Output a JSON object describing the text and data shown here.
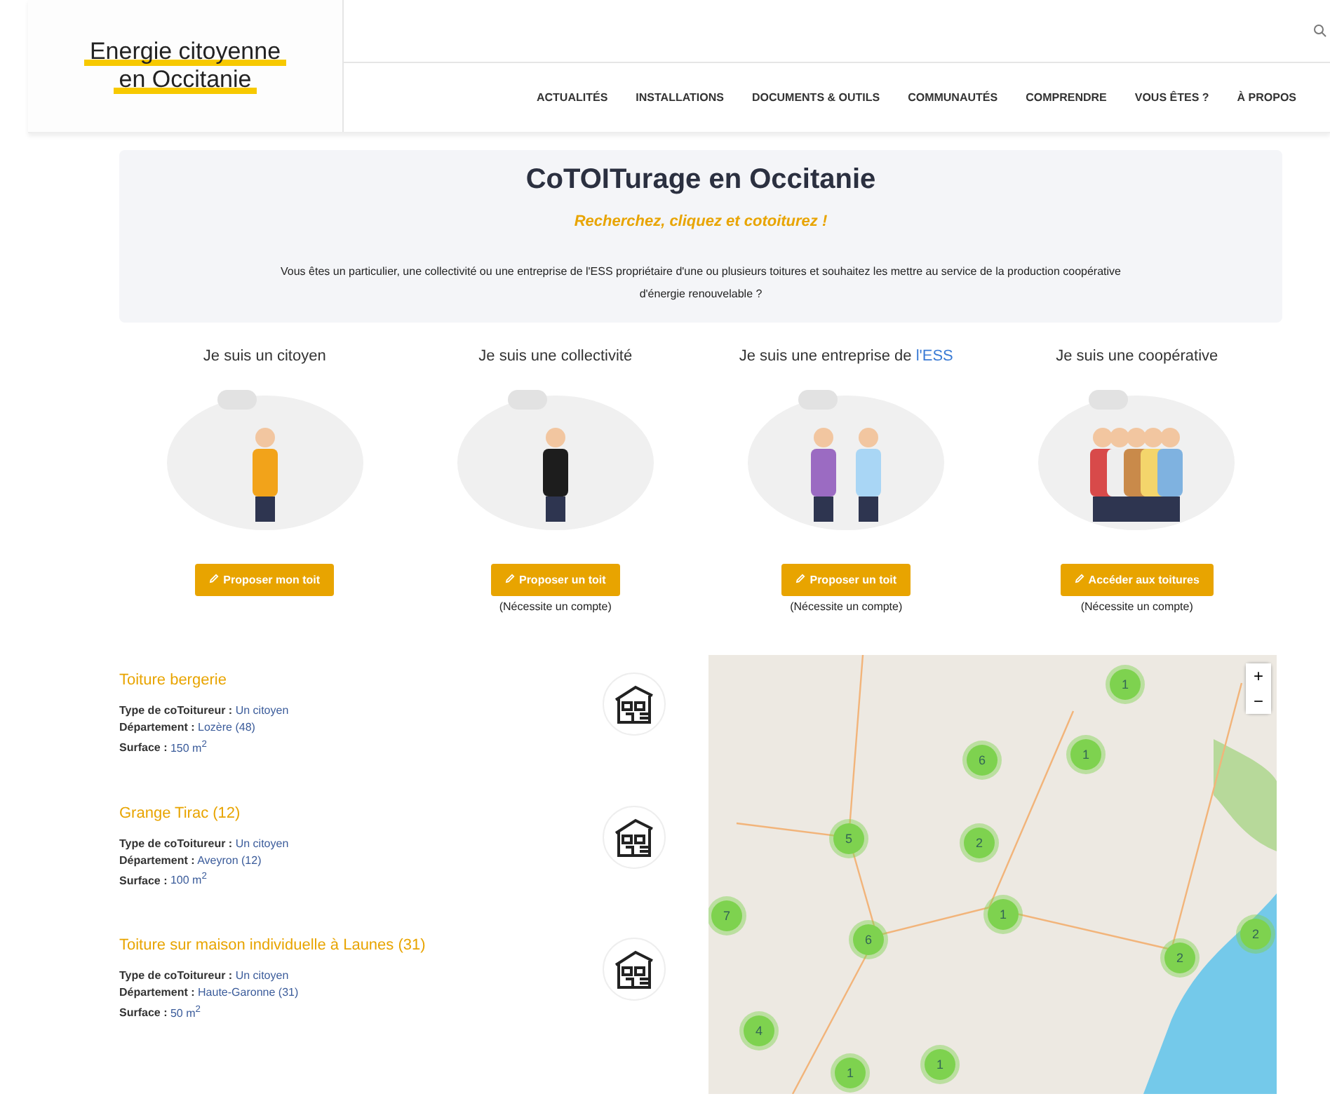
{
  "header": {
    "logo": [
      "Energie citoyenne",
      "en Occitanie"
    ],
    "nav": [
      "ACTUALITÉS",
      "INSTALLATIONS",
      "DOCUMENTS & OUTILS",
      "COMMUNAUTÉS",
      "COMPRENDRE",
      "VOUS ÊTES ?",
      "À PROPOS"
    ]
  },
  "hero": {
    "title": "CoTOITurage en Occitanie",
    "subtitle": "Recherchez, cliquez et cotoiturez !",
    "text": "Vous êtes un particulier, une collectivité ou une entreprise de l'ESS propriétaire d'une ou plusieurs toitures et souhaitez les mettre au service de la production coopérative d'énergie renouvelable ?"
  },
  "personas": [
    {
      "title": "Je suis un citoyen",
      "button": "Proposer mon toit"
    },
    {
      "title": "Je suis une collectivité",
      "button": "Proposer un toit",
      "note": "(Nécessite un compte)"
    },
    {
      "title": "Je suis une entreprise de *l'ESS*",
      "button": "Proposer un toit",
      "note": "(Nécessite un compte)"
    },
    {
      "title": "Je suis une coopérative",
      "button": "Accéder aux toitures",
      "note": "(Nécessite un compte)"
    }
  ],
  "listings": [
    {
      "title": "Toiture bergerie",
      "fields": [
        {
          "label": "Type de coToitureur :",
          "value": "Un citoyen"
        },
        {
          "label": "Département :",
          "value": "Lozère (48)"
        },
        {
          "label": "Surface :",
          "value": "150 m$^{2}$"
        }
      ]
    },
    {
      "title": "Grange Tirac (12)",
      "fields": [
        {
          "label": "Type de coToitureur :",
          "value": "Un citoyen"
        },
        {
          "label": "Département :",
          "value": "Aveyron (12)"
        },
        {
          "label": "Surface :",
          "value": "100 m$^{2}$"
        }
      ]
    },
    {
      "title": "Toiture sur maison individuelle à Launes (31)",
      "fields": [
        {
          "label": "Type de coToitureur :",
          "value": "Un citoyen"
        },
        {
          "label": "Département :",
          "value": "Haute-Garonne (31)"
        },
        {
          "label": "Surface :",
          "value": "50 m$^{2}$"
        }
      ]
    }
  ],
  "map": {
    "zoom_in": "+",
    "zoom_out": "−",
    "clusters": [
      "1",
      "6",
      "1",
      "5",
      "2",
      "7",
      "1",
      "6",
      "2",
      "2",
      "4",
      "1",
      "1"
    ]
  }
}
